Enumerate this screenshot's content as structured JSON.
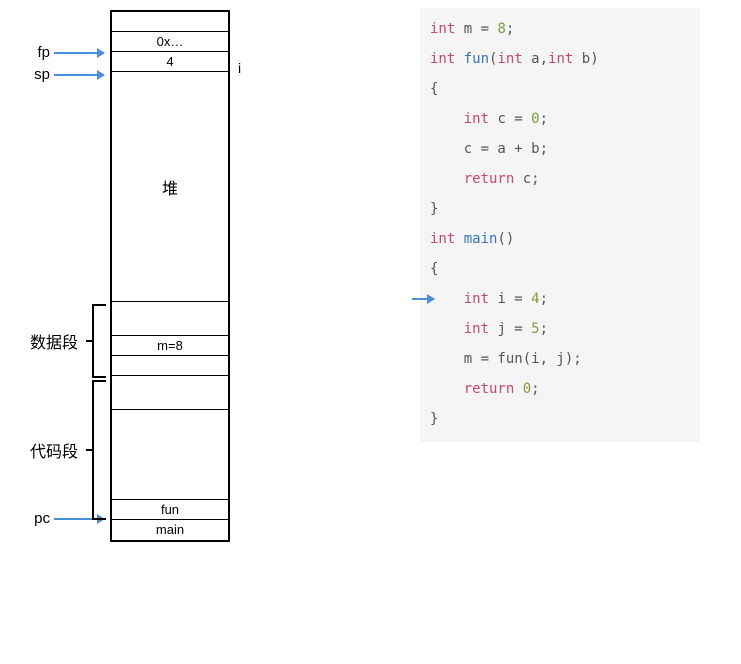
{
  "pointers": {
    "fp": "fp",
    "sp": "sp",
    "pc": "pc"
  },
  "regions": {
    "data_segment": "数据段",
    "code_segment": "代码段"
  },
  "cells": {
    "top_blank": "",
    "ret_addr": "0x…",
    "i_val": "4",
    "i_side": "i",
    "heap": "堆",
    "m_global": "m=8",
    "fun": "fun",
    "main": "main"
  },
  "code": {
    "l1_kw": "int",
    "l1_rest": " m = ",
    "l1_num": "8",
    "l1_end": ";",
    "l2_kw": "int",
    "l2_fn": " fun",
    "l2_sig1": "(",
    "l2_kwa": "int",
    "l2_a": " a,",
    "l2_kwb": "int",
    "l2_b": " b)",
    "l3": "{",
    "l4_kw": "int",
    "l4_rest": " c = ",
    "l4_num": "0",
    "l4_end": ";",
    "l5": "c = a + b;",
    "l6_kw": "return",
    "l6_rest": " c;",
    "l7": "}",
    "l8_kw": "int",
    "l8_fn": " main",
    "l8_rest": "()",
    "l9": "{",
    "l10_kw": "int",
    "l10_rest": " i = ",
    "l10_num": "4",
    "l10_end": ";",
    "l11_kw": "int",
    "l11_rest": " j = ",
    "l11_num": "5",
    "l11_end": ";",
    "l12_a": "m = fun(i, j);",
    "l13_kw": "return",
    "l13_sp": " ",
    "l13_num": "0",
    "l13_end": ";",
    "l14": "}"
  }
}
